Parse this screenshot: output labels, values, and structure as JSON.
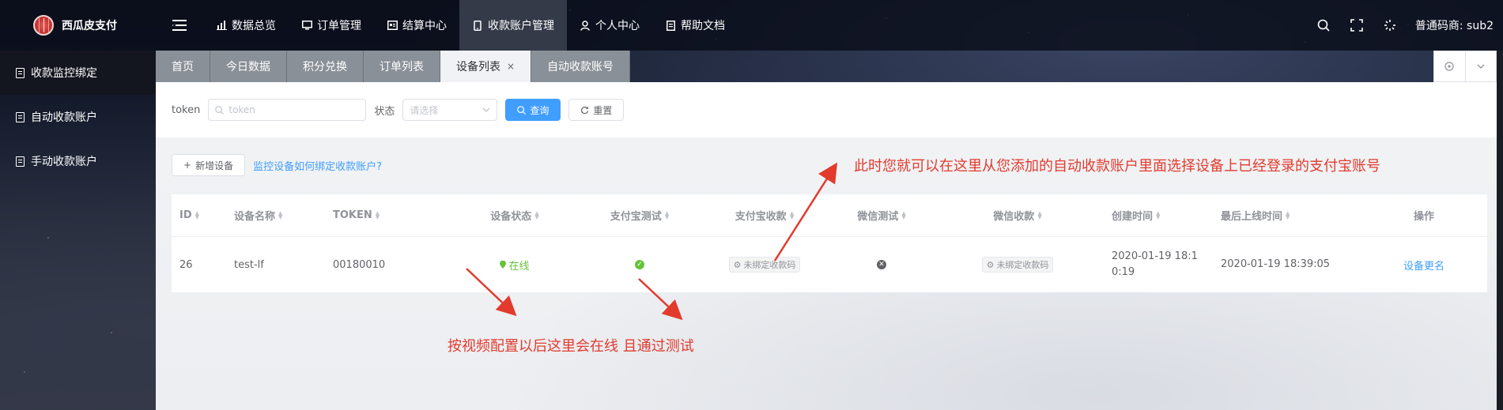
{
  "app": {
    "logo_text": "西瓜皮支付"
  },
  "nav": [
    {
      "label": "数据总览",
      "icon": "chart-icon"
    },
    {
      "label": "订单管理",
      "icon": "monitor-icon"
    },
    {
      "label": "结算中心",
      "icon": "card-icon"
    },
    {
      "label": "收款账户管理",
      "icon": "phone-icon",
      "active": true
    },
    {
      "label": "个人中心",
      "icon": "user-icon"
    },
    {
      "label": "帮助文档",
      "icon": "doc-icon"
    }
  ],
  "header": {
    "user": "普通码商: sub2"
  },
  "sidebar": [
    {
      "label": "收款监控绑定",
      "active": true
    },
    {
      "label": "自动收款账户"
    },
    {
      "label": "手动收款账户"
    }
  ],
  "tabs": [
    {
      "label": "首页"
    },
    {
      "label": "今日数据"
    },
    {
      "label": "积分兑换"
    },
    {
      "label": "订单列表"
    },
    {
      "label": "设备列表",
      "active": true,
      "close": "×"
    },
    {
      "label": "自动收款账号"
    }
  ],
  "filter": {
    "token_label": "token",
    "token_placeholder": "token",
    "status_label": "状态",
    "status_placeholder": "请选择",
    "search_label": "查询",
    "reset_label": "重置"
  },
  "toolbar": {
    "add_label": "新增设备",
    "help_link": "监控设备如何绑定收款账户?"
  },
  "table": {
    "columns": [
      "ID",
      "设备名称",
      "TOKEN",
      "设备状态",
      "支付宝测试",
      "支付宝收款",
      "微信测试",
      "微信收款",
      "创建时间",
      "最后上线时间",
      "操作"
    ],
    "rows": [
      {
        "id": "26",
        "name": "test-lf",
        "token": "00180010",
        "status": "在线",
        "alipay_test": "pass",
        "alipay_account": "未绑定收款码",
        "wechat_test": "fail",
        "wechat_account": "未绑定收款码",
        "created": "2020-01-19 18:10:19",
        "last_online": "2020-01-19 18:39:05",
        "action": "设备更名"
      }
    ]
  },
  "annotations": {
    "top": "此时您就可以在这里从您添加的自动收款账户里面选择设备上已经登录的支付宝账号",
    "bottom": "按视频配置以后这里会在线 且通过测试"
  },
  "colors": {
    "accent": "#409eff",
    "online": "#67c23a",
    "annotation": "#e23b2e"
  }
}
